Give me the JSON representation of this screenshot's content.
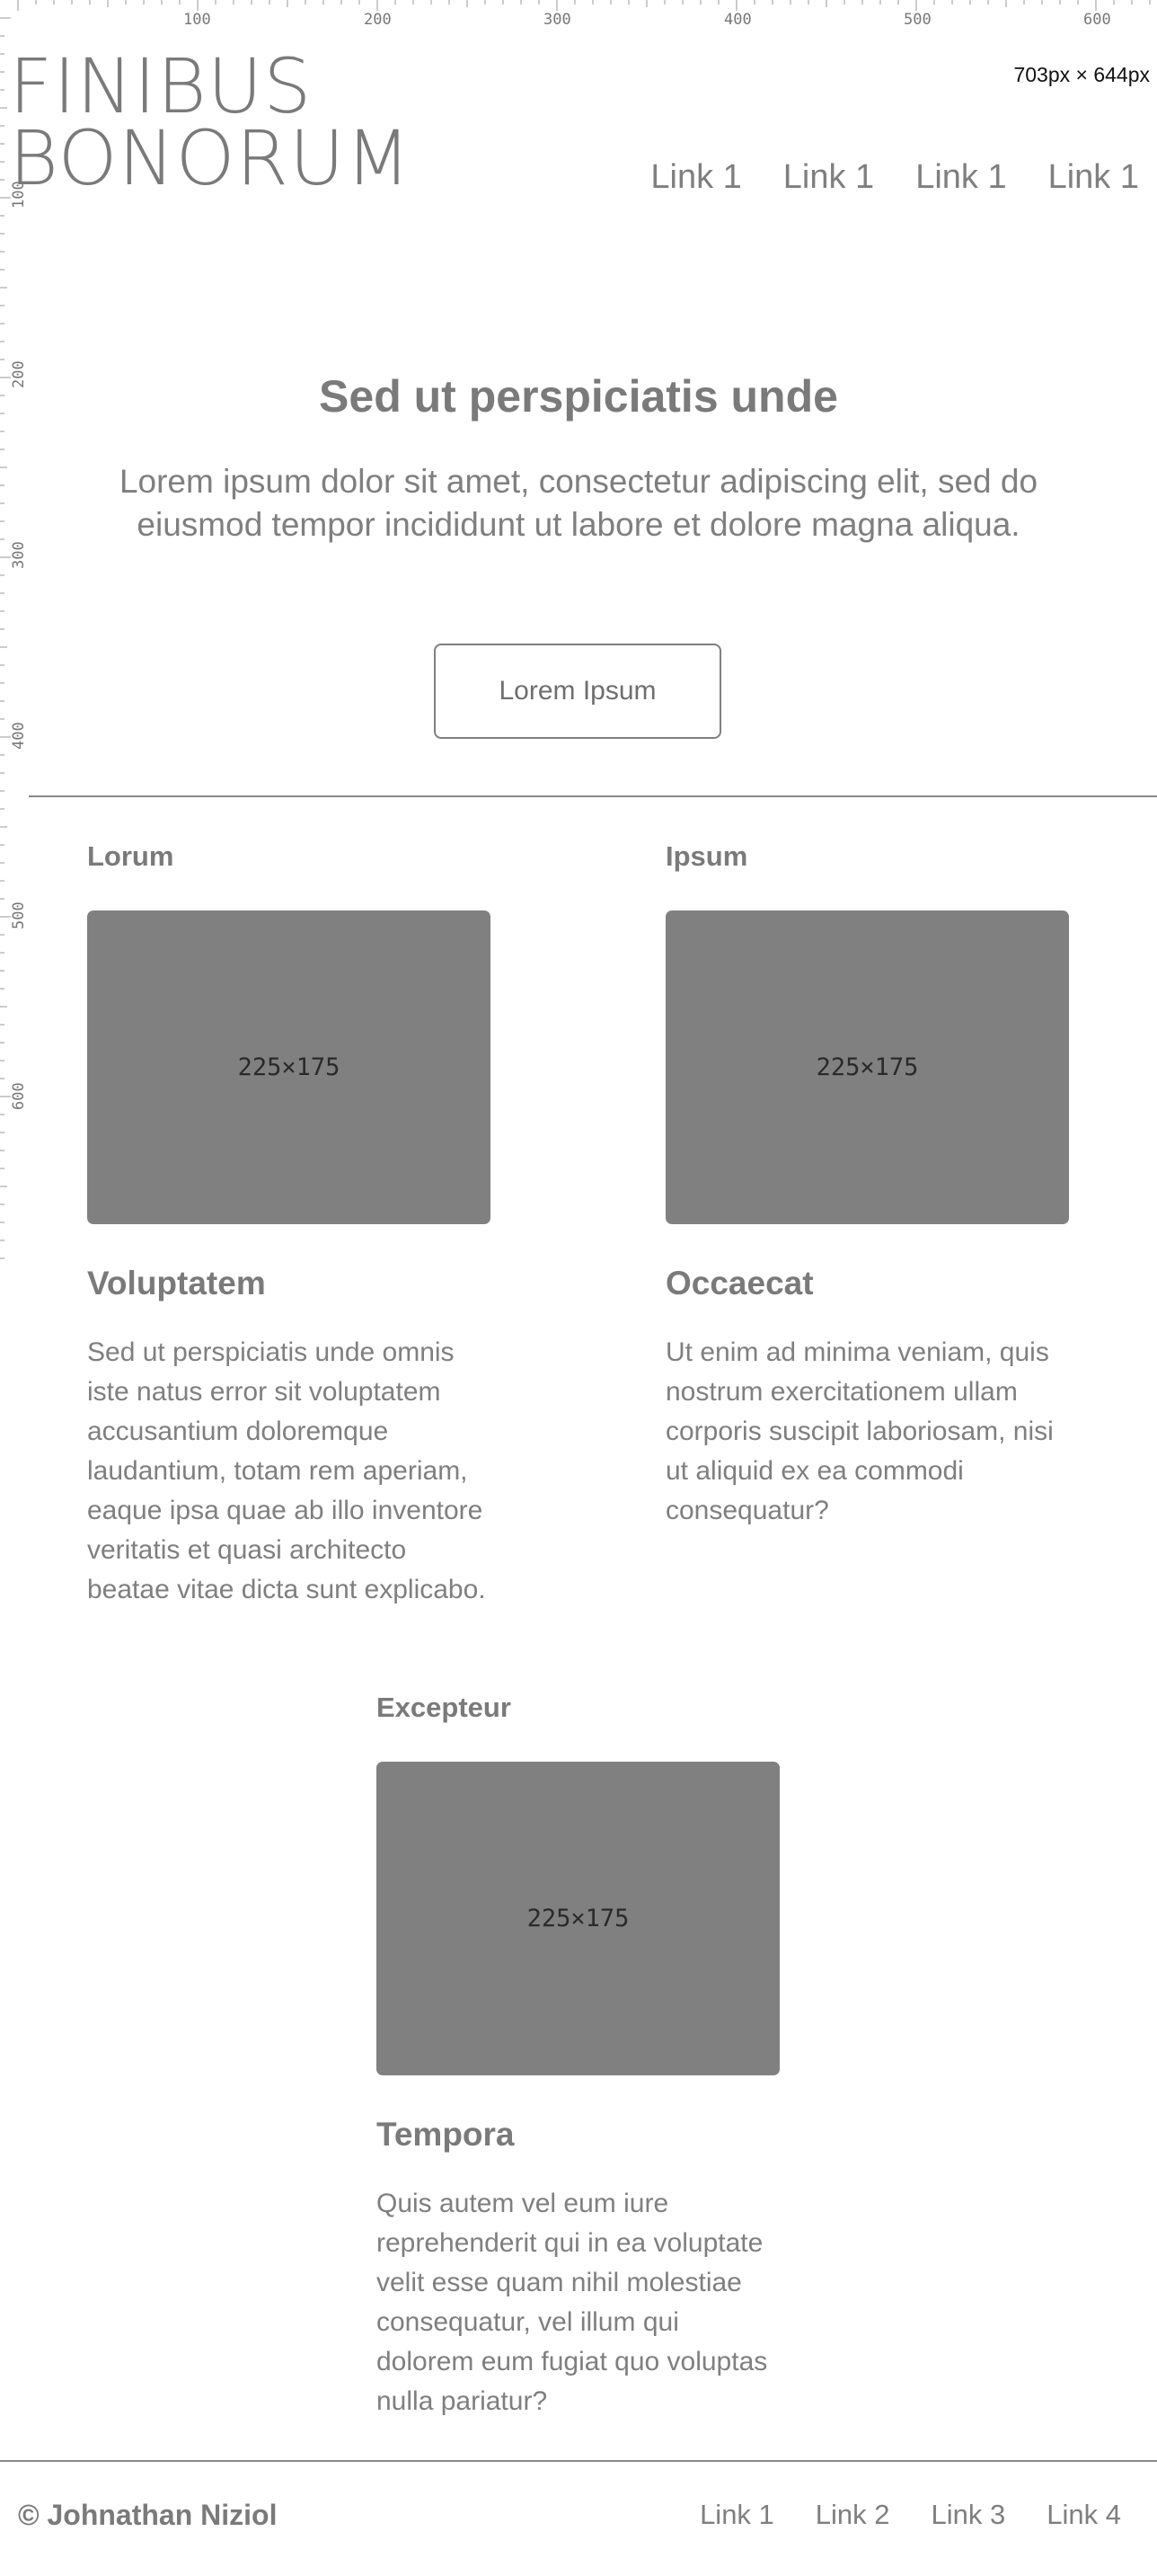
{
  "ruler": {
    "top_labels": [
      "100",
      "200",
      "300",
      "400",
      "500",
      "600"
    ],
    "left_labels": [
      "100",
      "200",
      "300",
      "400",
      "500",
      "600"
    ]
  },
  "viewport_size": "703px × 644px",
  "header": {
    "logo_line1": "FINIBUS",
    "logo_line2": "BONORUM",
    "nav": [
      "Link 1",
      "Link 1",
      "Link 1",
      "Link 1"
    ]
  },
  "hero": {
    "title": "Sed ut perspiciatis unde",
    "text": "Lorem ipsum dolor sit amet, consectetur adipiscing elit, sed do eiusmod tempor incididunt ut labore et dolore magna aliqua.",
    "button_label": "Lorem Ipsum"
  },
  "cards": [
    {
      "label": "Lorum",
      "image_text": "225×175",
      "title": "Voluptatem",
      "text": "Sed ut perspiciatis unde omnis iste natus error sit voluptatem accusantium doloremque laudantium, totam rem aperiam, eaque ipsa quae ab illo inventore veritatis et quasi architecto beatae vitae dicta sunt explicabo."
    },
    {
      "label": "Ipsum",
      "image_text": "225×175",
      "title": "Occaecat",
      "text": "Ut enim ad minima veniam, quis nostrum exercitationem ullam corporis suscipit laboriosam, nisi ut aliquid ex ea commodi consequatur?"
    },
    {
      "label": "Excepteur",
      "image_text": "225×175",
      "title": "Tempora",
      "text": "Quis autem vel eum iure reprehenderit qui in ea voluptate velit esse quam nihil molestiae consequatur, vel illum qui dolorem eum fugiat quo voluptas nulla pariatur?"
    }
  ],
  "footer": {
    "copyright": "© Johnathan Niziol",
    "nav": [
      "Link 1",
      "Link 2",
      "Link 3",
      "Link 4"
    ]
  }
}
